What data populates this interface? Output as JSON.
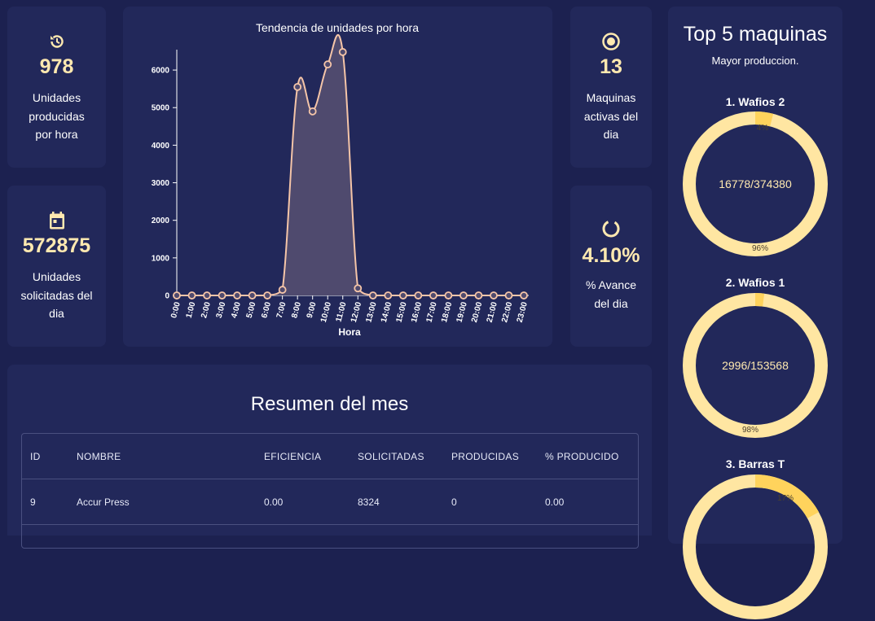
{
  "stats": {
    "units_per_hour": {
      "value": "978",
      "label": "Unidades producidas por hora",
      "icon": "history-icon"
    },
    "requested_day": {
      "value": "572875",
      "label": "Unidades solicitadas del dia",
      "icon": "calendar-icon"
    },
    "active_machines": {
      "value": "13",
      "label": "Maquinas activas del dia",
      "icon": "target-icon"
    },
    "progress": {
      "value": "4.10%",
      "label": "% Avance del dia",
      "icon": "progress-ring-icon"
    }
  },
  "colors": {
    "background": "#1c2150",
    "card": "#22285a",
    "accent": "#ffe9b0",
    "donut_fill": "#ffd35c",
    "donut_track": "#ffe6a2",
    "line": "#f5c5a8",
    "area": "#4f4a6e"
  },
  "chart_data": {
    "type": "area",
    "title": "Tendencia de unidades por hora",
    "xlabel": "Hora",
    "ylabel": "",
    "ylim": [
      0,
      6500
    ],
    "yticks": [
      0,
      1000,
      2000,
      3000,
      4000,
      5000,
      6000
    ],
    "x": [
      "0:00",
      "1:00",
      "2:00",
      "3:00",
      "4:00",
      "5:00",
      "6:00",
      "7:00",
      "8:00",
      "9:00",
      "10:00",
      "11:00",
      "12:00",
      "13:00",
      "14:00",
      "15:00",
      "16:00",
      "17:00",
      "18:00",
      "19:00",
      "20:00",
      "21:00",
      "22:00",
      "23:00"
    ],
    "series": [
      {
        "values": [
          0,
          0,
          0,
          0,
          0,
          0,
          0,
          150,
          5550,
          4900,
          6150,
          6480,
          190,
          0,
          0,
          0,
          0,
          0,
          0,
          0,
          0,
          0,
          0,
          0
        ]
      }
    ],
    "grid": false,
    "legend": "none"
  },
  "summary": {
    "title": "Resumen del mes",
    "columns": [
      "ID",
      "NOMBRE",
      "EFICIENCIA",
      "SOLICITADAS",
      "PRODUCIDAS",
      "% PRODUCIDO"
    ],
    "rows": [
      [
        "9",
        "Accur Press",
        "0.00",
        "8324",
        "0",
        "0.00"
      ]
    ]
  },
  "top": {
    "title": "Top 5 maquinas",
    "subtitle": "Mayor produccion.",
    "machines": [
      {
        "name": "1. Wafios 2",
        "center": "16778/374380",
        "pct_done": 4,
        "label_done": "4%",
        "label_rest": "96%"
      },
      {
        "name": "2. Wafios 1",
        "center": "2996/153568",
        "pct_done": 2,
        "label_done": "",
        "label_rest": "98%"
      },
      {
        "name": "3. Barras T",
        "center": "",
        "pct_done": 17,
        "label_done": "17%",
        "label_rest": ""
      }
    ]
  }
}
